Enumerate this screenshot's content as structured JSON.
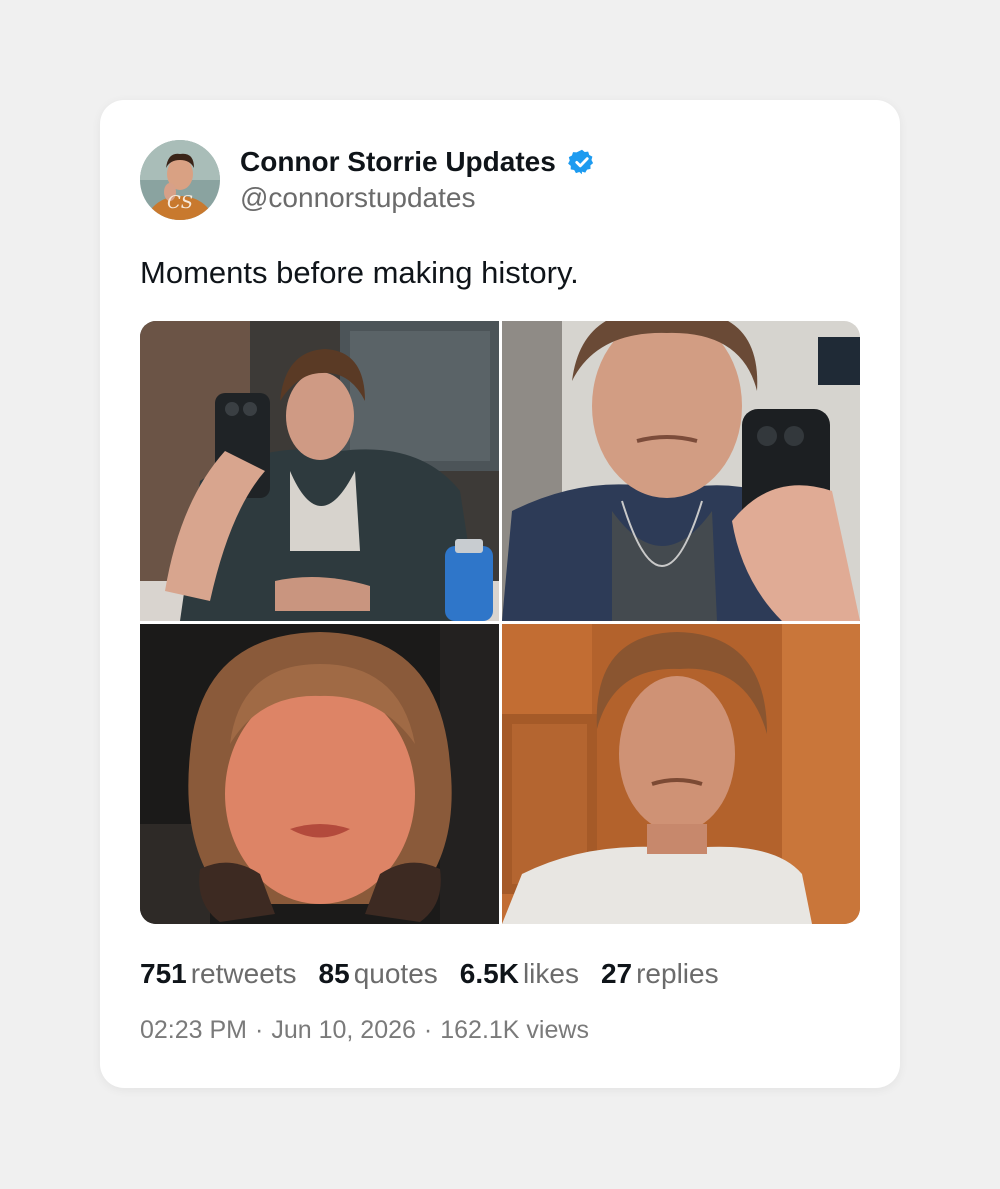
{
  "tweet": {
    "display_name": "Connor Storrie Updates",
    "handle": "@connorstupdates",
    "verified": true,
    "avatar_monogram": "CS",
    "text": "Moments before making history.",
    "photos": [
      {
        "icon": "selfie-plaid-shirt-photo"
      },
      {
        "icon": "selfie-denim-jacket-photo"
      },
      {
        "icon": "selfie-headphones-photo"
      },
      {
        "icon": "portrait-wood-wall-photo"
      }
    ],
    "stats": {
      "retweets_count": "751",
      "retweets_label": "retweets",
      "quotes_count": "85",
      "quotes_label": "quotes",
      "likes_count": "6.5K",
      "likes_label": "likes",
      "replies_count": "27",
      "replies_label": "replies"
    },
    "time": "02:23 PM",
    "date": "Jun 10, 2026",
    "views": "162.1K views",
    "separator": "·"
  },
  "colors": {
    "background": "#f0f0f0",
    "card": "#ffffff",
    "text_primary": "#0f1419",
    "text_secondary": "#6b6b6b",
    "verified_blue": "#1d9bf0"
  }
}
